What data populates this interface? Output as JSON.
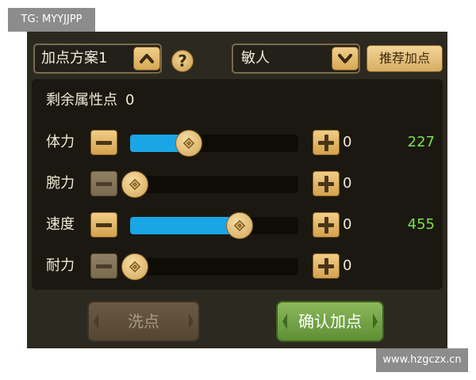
{
  "watermarks": {
    "top_left": "TG: MYYJJPP",
    "bottom_right": "www.hzgczx.cn"
  },
  "topbar": {
    "scheme_label": "加点方案1",
    "scheme_arrow_icon": "chevron-up-icon",
    "help_label": "?",
    "class_label": "敏人",
    "class_arrow_icon": "chevron-down-icon",
    "recommend_label": "推荐加点"
  },
  "panel": {
    "remaining_label": "剩余属性点",
    "remaining_value": "0",
    "stats": [
      {
        "name": "体力",
        "allocated": "0",
        "total": "227",
        "level": 0.35,
        "minus_enabled": true
      },
      {
        "name": "腕力",
        "allocated": "0",
        "total": "",
        "level": 0.0,
        "minus_enabled": false
      },
      {
        "name": "速度",
        "allocated": "0",
        "total": "455",
        "level": 0.65,
        "minus_enabled": true
      },
      {
        "name": "耐力",
        "allocated": "0",
        "total": "",
        "level": 0.0,
        "minus_enabled": false
      }
    ]
  },
  "buttons": {
    "reset_label": "洗点",
    "confirm_label": "确认加点"
  },
  "colors": {
    "panel_bg": "#1b1811",
    "slider_fill": "#1aa6e6",
    "total_text": "#7be14a",
    "button_gold": "#d8ad62"
  }
}
